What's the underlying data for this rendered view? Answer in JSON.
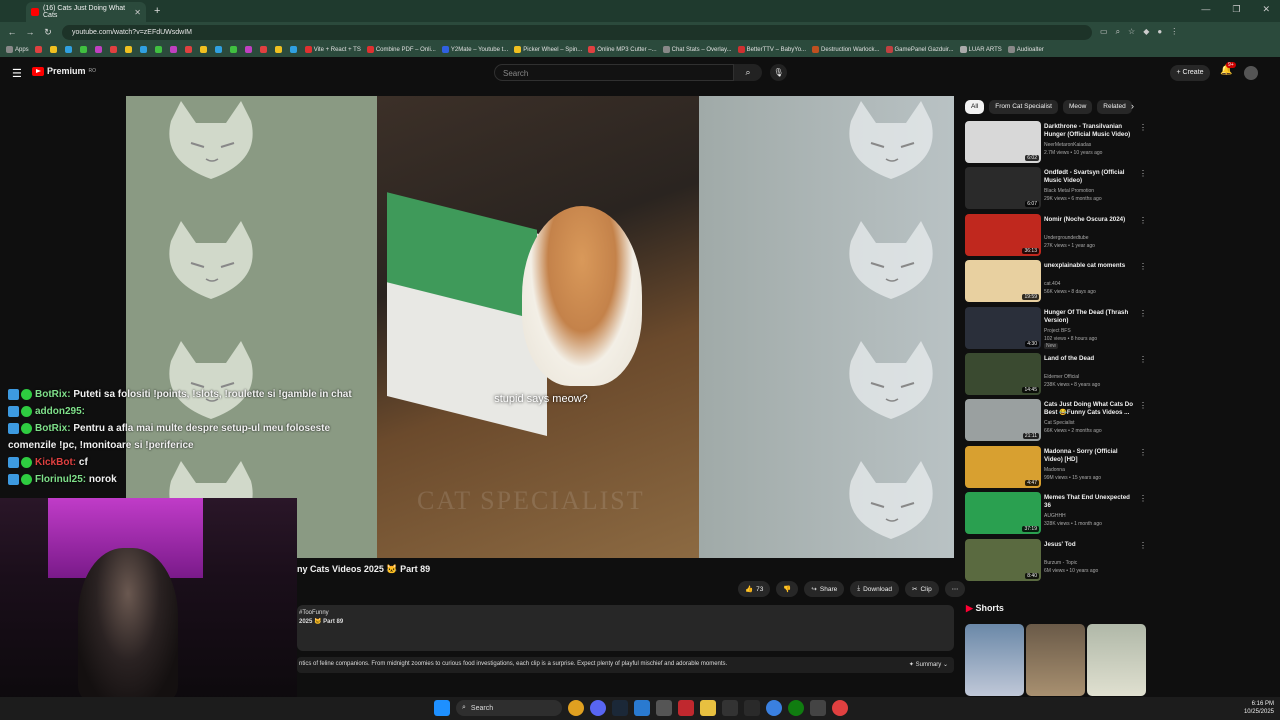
{
  "browser": {
    "tab_title": "(16) Cats Just Doing What Cats",
    "url": "youtube.com/watch?v=zEFdUWsdwIM",
    "bookmarks": [
      "Apps",
      "Vite + React + TS",
      "Combine PDF – Onli...",
      "Y2Mate – Youtube t...",
      "Picker Wheel – Spin...",
      "Online MP3 Cutter –...",
      "Chat Stats – Overlay...",
      "BetterTTV – BabyYo...",
      "Destruction Warlock...",
      "GamePanel Gazduir...",
      "LUAR ARTS",
      "Audioalter"
    ]
  },
  "header": {
    "logo": "Premium",
    "logo_sup": "RO",
    "search_placeholder": "Search",
    "create_label": "Create",
    "notif_count": "9+"
  },
  "video": {
    "caption": "stupid says meow?",
    "watermark": "CAT SPECIALIST",
    "title": "ny Cats Videos 2025 🐱 Part 89",
    "likes": "73",
    "share": "Share",
    "download": "Download",
    "clip": "Clip",
    "desc_tag": "#TooFunny",
    "desc_line": "2025 🐱 Part 89",
    "desc_text": "ntics of feline companions. From midnight zoomies to curious food investigations, each clip is a surprise. Expect plenty of playful mischief and adorable moments.",
    "summary": "Summary"
  },
  "chips": [
    "All",
    "From Cat Specialist",
    "Meow",
    "Related"
  ],
  "recs": [
    {
      "title": "Darkthrone - Transilvanian Hunger (Official Music Video)",
      "channel": "NeerMetaronKaiadas",
      "meta": "2.7M views • 10 years ago",
      "dur": "6:02",
      "color": "#d8d8d8"
    },
    {
      "title": "Ondfødt - Svartsyn (Official Music Video)",
      "channel": "Black Metal Promotion",
      "meta": "29K views • 6 months ago",
      "dur": "6:07",
      "color": "#2a2a2a"
    },
    {
      "title": "Nomir (Noche Oscura 2024)",
      "channel": "Undergroundedtube",
      "meta": "27K views • 1 year ago",
      "dur": "36:13",
      "color": "#c0281e"
    },
    {
      "title": "unexplainable cat moments",
      "channel": "cat.404",
      "meta": "56K views • 8 days ago",
      "dur": "19:59",
      "color": "#e8d0a0"
    },
    {
      "title": "Hunger Of The Dead (Thrash Version)",
      "channel": "Project BFS",
      "meta": "102 views • 8 hours ago",
      "dur": "4:30",
      "color": "#2a2f3a",
      "badge": "New"
    },
    {
      "title": "Land of the Dead",
      "channel": "Eldemer Official",
      "meta": "238K views • 8 years ago",
      "dur": "14:45",
      "color": "#3a4a30"
    },
    {
      "title": "Cats Just Doing What Cats Do Best 😂Funny Cats Videos ...",
      "channel": "Cat Specialist",
      "meta": "66K views • 2 months ago",
      "dur": "21:11",
      "color": "#9aa0a0"
    },
    {
      "title": "Madonna - Sorry (Official Video) [HD]",
      "channel": "Madonna",
      "meta": "99M views • 15 years ago",
      "dur": "4:47",
      "color": "#d8a030"
    },
    {
      "title": "Memes That End Unexpected 36",
      "channel": "AUGHHH",
      "meta": "328K views • 1 month ago",
      "dur": "37:19",
      "color": "#2aa050"
    },
    {
      "title": "Jesus' Tod",
      "channel": "Burzum - Topic",
      "meta": "6M views • 10 years ago",
      "dur": "8:40",
      "color": "#5a6a40"
    }
  ],
  "shorts_title": "Shorts",
  "chat": [
    {
      "user": "BotRix:",
      "msg": "Puteti sa folositi !points, !slots, !roulette si !gamble in chat"
    },
    {
      "user": "addon295:",
      "msg": ""
    },
    {
      "user": "BotRix:",
      "msg": "Pentru a afla mai multe despre setup-ul meu foloseste"
    },
    {
      "user": "",
      "msg": "comenzile !pc, !monitoare si !periferice"
    },
    {
      "user": "KickBot:",
      "msg": "cf"
    },
    {
      "user": "Florinul25:",
      "msg": "norok"
    }
  ],
  "taskbar": {
    "search": "Search",
    "time": "6:16 PM",
    "date": "10/25/2025"
  }
}
